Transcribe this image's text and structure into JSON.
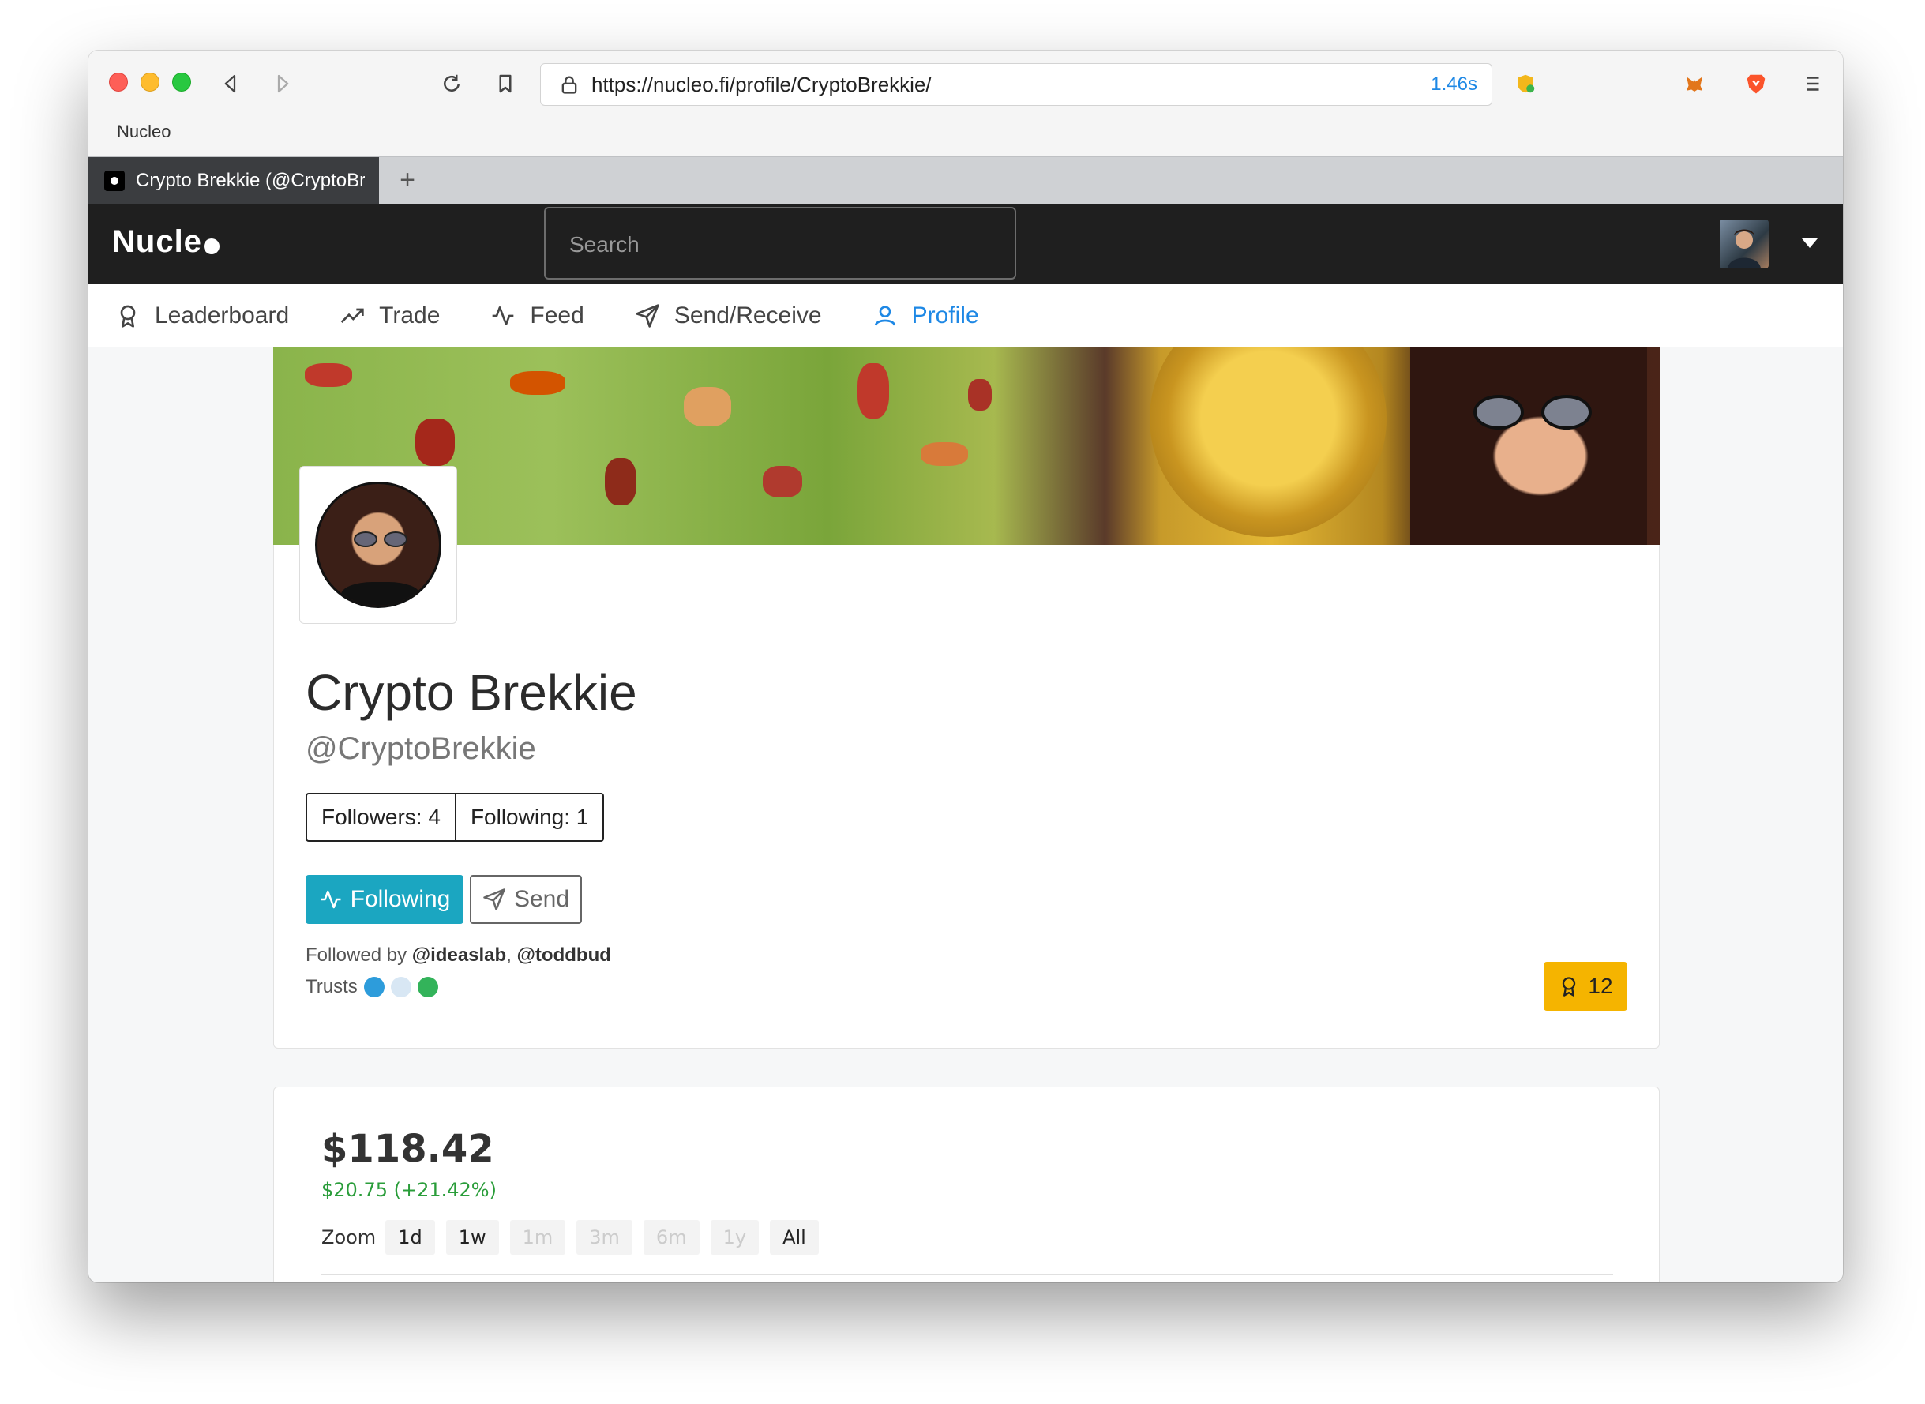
{
  "browser": {
    "url": "https://nucleo.fi/profile/CryptoBrekkie/",
    "load_time": "1.46s",
    "bookmark": "Nucleo",
    "tab_title": "Crypto Brekkie (@CryptoBrekkie)",
    "new_tab": "+"
  },
  "app": {
    "logo": "Nucle",
    "search_placeholder": "Search"
  },
  "nav": {
    "leaderboard": "Leaderboard",
    "trade": "Trade",
    "feed": "Feed",
    "send_receive": "Send/Receive",
    "profile": "Profile"
  },
  "profile": {
    "name": "Crypto Brekkie",
    "handle": "@CryptoBrekkie",
    "followers": "Followers: 4",
    "following_count": "Following: 1",
    "following_button": "Following",
    "send_button": "Send",
    "followed_by_prefix": "Followed by",
    "followed_by_1": "@ideaslab",
    "followed_by_sep": ",",
    "followed_by_2": "@toddbud",
    "trusts_label": "Trusts",
    "rank": "12"
  },
  "portfolio": {
    "balance": "$118.42",
    "change": "$20.75 (+21.42%)",
    "zoom_label": "Zoom",
    "zoom_options": [
      "1d",
      "1w",
      "1m",
      "3m",
      "6m",
      "1y",
      "All"
    ]
  },
  "colors": {
    "accent": "#1e88e5",
    "following_btn": "#1ba6c1",
    "badge": "#f5b400",
    "gain": "#2a9d3a"
  }
}
